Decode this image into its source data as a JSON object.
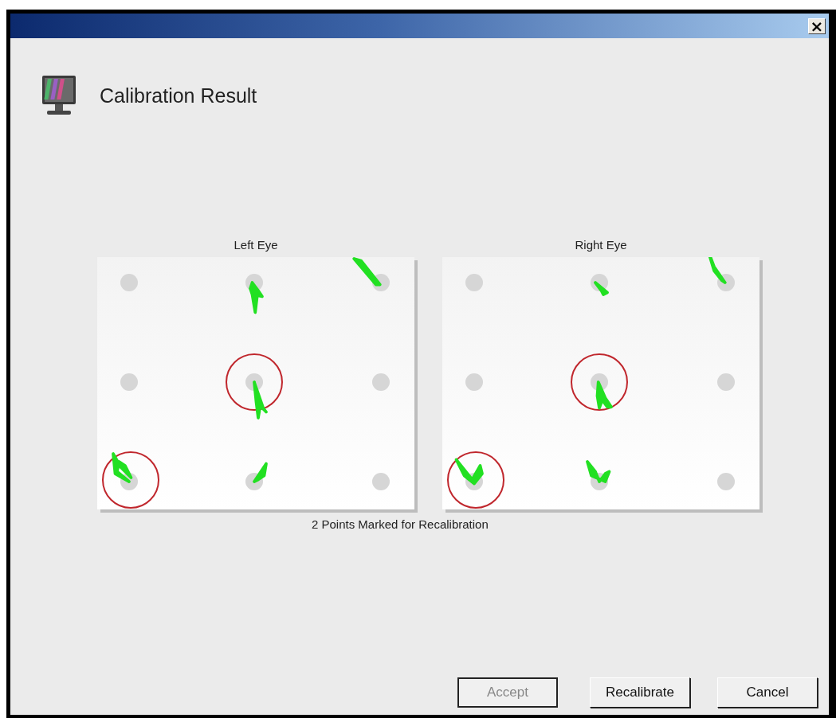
{
  "window": {
    "close_button": "×"
  },
  "header": {
    "title": "Calibration Result"
  },
  "eyes": [
    {
      "label": "Left Eye",
      "points": [
        {
          "marked": false
        },
        {
          "marked": false
        },
        {
          "marked": false
        },
        {
          "marked": false
        },
        {
          "marked": true
        },
        {
          "marked": false
        },
        {
          "marked": true
        },
        {
          "marked": false
        },
        {
          "marked": false
        }
      ]
    },
    {
      "label": "Right Eye",
      "points": [
        {
          "marked": false
        },
        {
          "marked": false
        },
        {
          "marked": false
        },
        {
          "marked": false
        },
        {
          "marked": true
        },
        {
          "marked": false
        },
        {
          "marked": true
        },
        {
          "marked": false
        },
        {
          "marked": false
        }
      ]
    }
  ],
  "status": "2 Points Marked for Recalibration",
  "buttons": [
    {
      "label": "Accept",
      "disabled": true
    },
    {
      "label": "Recalibrate",
      "disabled": false
    },
    {
      "label": "Cancel",
      "disabled": false
    }
  ]
}
